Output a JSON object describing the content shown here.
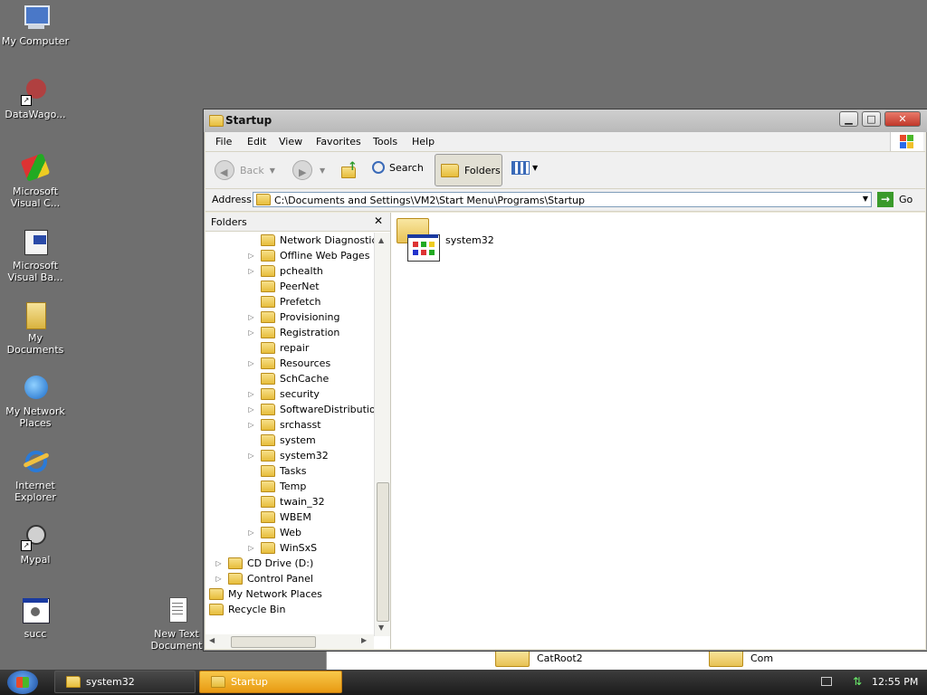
{
  "desktop": {
    "icons": [
      {
        "label": "My Computer",
        "icon": "computer-icon"
      },
      {
        "label": "DataWago...",
        "icon": "datawagon-icon"
      },
      {
        "label": "Microsoft Visual C...",
        "icon": "visual-c-icon"
      },
      {
        "label": "Microsoft Visual Ba...",
        "icon": "visual-basic-icon"
      },
      {
        "label": "My Documents",
        "icon": "documents-icon"
      },
      {
        "label": "My Network Places",
        "icon": "network-icon"
      },
      {
        "label": "Internet Explorer",
        "icon": "ie-icon"
      },
      {
        "label": "Mypal",
        "icon": "mypal-icon"
      },
      {
        "label": "succ",
        "icon": "app-icon"
      },
      {
        "label": "New Text Document",
        "icon": "text-document-icon"
      }
    ],
    "behind_items": [
      "CatRoot2",
      "Com"
    ]
  },
  "window": {
    "title": "Startup",
    "minimize": "▁",
    "maximize": "□",
    "close": "✕",
    "menu": [
      "File",
      "Edit",
      "View",
      "Favorites",
      "Tools",
      "Help"
    ],
    "toolbar": {
      "back": "Back",
      "search": "Search",
      "folders": "Folders"
    },
    "address": {
      "label": "Address",
      "value": "C:\\Documents and Settings\\VM2\\Start Menu\\Programs\\Startup",
      "go": "Go"
    },
    "folders_pane": {
      "title": "Folders",
      "items": [
        {
          "label": "Network Diagnostic",
          "expandable": false,
          "level": 3
        },
        {
          "label": "Offline Web Pages",
          "expandable": true,
          "level": 3
        },
        {
          "label": "pchealth",
          "expandable": true,
          "level": 3
        },
        {
          "label": "PeerNet",
          "expandable": false,
          "level": 3
        },
        {
          "label": "Prefetch",
          "expandable": false,
          "level": 3
        },
        {
          "label": "Provisioning",
          "expandable": true,
          "level": 3
        },
        {
          "label": "Registration",
          "expandable": true,
          "level": 3
        },
        {
          "label": "repair",
          "expandable": false,
          "level": 3
        },
        {
          "label": "Resources",
          "expandable": true,
          "level": 3
        },
        {
          "label": "SchCache",
          "expandable": false,
          "level": 3
        },
        {
          "label": "security",
          "expandable": true,
          "level": 3
        },
        {
          "label": "SoftwareDistributio",
          "expandable": true,
          "level": 3
        },
        {
          "label": "srchasst",
          "expandable": true,
          "level": 3
        },
        {
          "label": "system",
          "expandable": false,
          "level": 3
        },
        {
          "label": "system32",
          "expandable": true,
          "level": 3
        },
        {
          "label": "Tasks",
          "expandable": false,
          "level": 3
        },
        {
          "label": "Temp",
          "expandable": false,
          "level": 3
        },
        {
          "label": "twain_32",
          "expandable": false,
          "level": 3
        },
        {
          "label": "WBEM",
          "expandable": false,
          "level": 3
        },
        {
          "label": "Web",
          "expandable": true,
          "level": 3
        },
        {
          "label": "WinSxS",
          "expandable": true,
          "level": 3
        },
        {
          "label": "CD Drive (D:)",
          "expandable": true,
          "level": 1
        },
        {
          "label": "Control Panel",
          "expandable": true,
          "level": 1
        },
        {
          "label": "My Network Places",
          "expandable": true,
          "level": 0
        },
        {
          "label": "Recycle Bin",
          "expandable": false,
          "level": 0
        }
      ]
    },
    "content": {
      "items": [
        {
          "label": "system32"
        }
      ]
    }
  },
  "taskbar": {
    "items": [
      {
        "label": "system32",
        "active": false
      },
      {
        "label": "Startup",
        "active": true
      }
    ],
    "clock": "12:55 PM"
  },
  "colors": {
    "desktop": "#6f6f6f",
    "active_task": "#f0a91e",
    "go_green": "#3a9a2a"
  }
}
